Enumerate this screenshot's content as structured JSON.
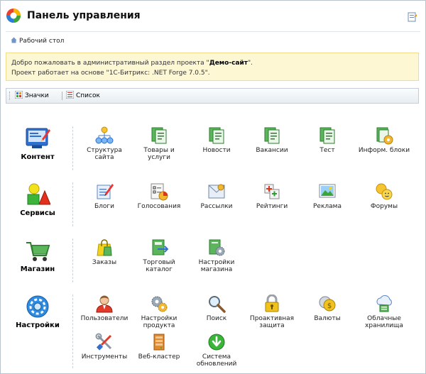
{
  "header": {
    "title": "Панель управления"
  },
  "breadcrumb": {
    "home": "Рабочий стол"
  },
  "notice": {
    "line1_pre": "Добро пожаловать в административный раздел проекта \"",
    "line1_bold": "Демо-сайт",
    "line1_post": "\".",
    "line2": "Проект работает на основе \"1С-Битрикс: .NET Forge 7.0.5\"."
  },
  "toolbar": {
    "icons_label": "Значки",
    "list_label": "Список"
  },
  "sections": {
    "content": {
      "label": "Контент",
      "items": [
        "Структура сайта",
        "Товары и услуги",
        "Новости",
        "Вакансии",
        "Тест",
        "Информ. блоки"
      ]
    },
    "services": {
      "label": "Сервисы",
      "items": [
        "Блоги",
        "Голосования",
        "Рассылки",
        "Рейтинги",
        "Реклама",
        "Форумы"
      ]
    },
    "shop": {
      "label": "Магазин",
      "items": [
        "Заказы",
        "Торговый каталог",
        "Настройки магазина"
      ]
    },
    "settings": {
      "label": "Настройки",
      "items": [
        "Пользователи",
        "Настройки продукта",
        "Поиск",
        "Проактивная защита",
        "Валюты",
        "Облачные хранилища",
        "Инструменты",
        "Веб-кластер",
        "Система обновлений"
      ]
    }
  }
}
